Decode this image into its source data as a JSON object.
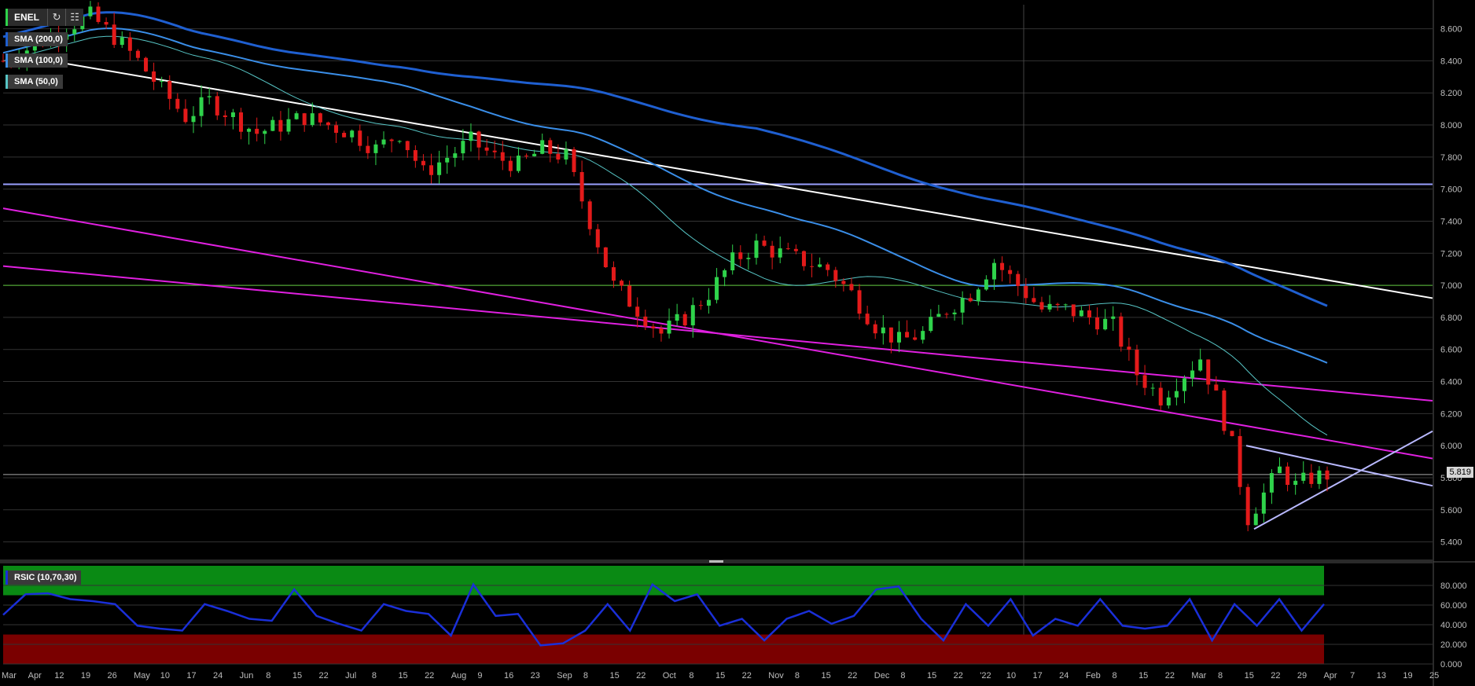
{
  "ticker": "ENEL",
  "toolbar": {
    "refresh_icon": "refresh-icon",
    "settings_icon": "bars-icon"
  },
  "legend": {
    "sma200": "SMA (200,0)",
    "sma100": "SMA (100,0)",
    "sma50": "SMA (50,0)"
  },
  "rsi_legend": "RSIC (10,70,30)",
  "last_price": "5.819",
  "colors": {
    "up": "#2fd34b",
    "down": "#e31a1a",
    "sma200": "#1f5fd0",
    "sma100": "#3a8ee8",
    "sma50": "#57c5c5",
    "channel": "#e020e0",
    "trend": "#ffffff",
    "resistance": "#9aa0ff",
    "support_green": "#5cc43a",
    "rsi": "#1a2fd8",
    "rsi_overbought": "#0a8a14",
    "rsi_oversold": "#7a0000"
  },
  "chart_data": {
    "type": "candlestick",
    "price_axis": {
      "range": [
        5.3,
        8.75
      ],
      "ticks": [
        "8.600",
        "8.400",
        "8.200",
        "8.000",
        "7.800",
        "7.600",
        "7.400",
        "7.200",
        "7.000",
        "6.800",
        "6.600",
        "6.400",
        "6.200",
        "6.000",
        "5.800",
        "5.600",
        "5.400"
      ]
    },
    "rsi_axis": {
      "range": [
        0,
        100
      ],
      "ticks": [
        "80.000",
        "60.000",
        "40.000",
        "20.000",
        "0.000"
      ]
    },
    "x_ticks": [
      "Mar",
      "Apr",
      "12",
      "19",
      "26",
      "May",
      "10",
      "17",
      "24",
      "Jun",
      "8",
      "15",
      "22",
      "Jul",
      "8",
      "15",
      "22",
      "Aug",
      "9",
      "16",
      "23",
      "Sep",
      "8",
      "15",
      "22",
      "Oct",
      "8",
      "15",
      "22",
      "Nov",
      "8",
      "15",
      "22",
      "Dec",
      "8",
      "15",
      "22",
      "'22",
      "10",
      "17",
      "24",
      "Feb",
      "8",
      "15",
      "22",
      "Mar",
      "8",
      "15",
      "22",
      "29",
      "Apr",
      "7",
      "13",
      "19",
      "25"
    ],
    "close_series": [
      [
        0,
        8.4
      ],
      [
        8,
        8.5
      ],
      [
        15,
        8.6
      ],
      [
        22,
        8.68
      ],
      [
        28,
        8.55
      ],
      [
        34,
        8.4
      ],
      [
        40,
        8.22
      ],
      [
        46,
        8.05
      ],
      [
        52,
        8.15
      ],
      [
        58,
        8.05
      ],
      [
        64,
        7.95
      ],
      [
        70,
        8.0
      ],
      [
        76,
        8.05
      ],
      [
        82,
        8.0
      ],
      [
        88,
        7.95
      ],
      [
        94,
        7.85
      ],
      [
        100,
        7.95
      ],
      [
        106,
        7.7
      ],
      [
        112,
        7.8
      ],
      [
        118,
        7.9
      ],
      [
        124,
        7.8
      ],
      [
        130,
        7.75
      ],
      [
        136,
        7.85
      ],
      [
        142,
        7.8
      ],
      [
        148,
        7.4
      ],
      [
        154,
        7.0
      ],
      [
        160,
        6.85
      ],
      [
        166,
        6.7
      ],
      [
        172,
        6.8
      ],
      [
        178,
        6.95
      ],
      [
        184,
        7.15
      ],
      [
        190,
        7.25
      ],
      [
        196,
        7.2
      ],
      [
        202,
        7.15
      ],
      [
        208,
        7.1
      ],
      [
        214,
        6.95
      ],
      [
        220,
        6.75
      ],
      [
        226,
        6.65
      ],
      [
        232,
        6.7
      ],
      [
        238,
        6.85
      ],
      [
        244,
        6.95
      ],
      [
        250,
        7.15
      ],
      [
        256,
        7.0
      ],
      [
        262,
        6.85
      ],
      [
        268,
        6.85
      ],
      [
        274,
        6.8
      ],
      [
        280,
        6.75
      ],
      [
        286,
        6.45
      ],
      [
        292,
        6.3
      ],
      [
        298,
        6.45
      ],
      [
        302,
        6.55
      ],
      [
        306,
        6.3
      ],
      [
        310,
        6.0
      ],
      [
        314,
        5.55
      ],
      [
        318,
        5.7
      ],
      [
        322,
        5.85
      ],
      [
        326,
        5.75
      ],
      [
        330,
        5.8
      ],
      [
        334,
        5.819
      ]
    ],
    "overlays": {
      "sma200_label": "SMA (200,0)",
      "sma100_label": "SMA (100,0)",
      "sma50_label": "SMA (50,0)",
      "horizontal_levels": [
        7.63,
        7.0,
        5.82
      ],
      "rsi_levels": [
        70,
        30
      ]
    },
    "rsi_series": [
      50,
      65,
      78,
      60,
      70,
      55,
      45,
      30,
      40,
      55,
      60,
      40,
      50,
      70,
      55,
      35,
      40,
      55,
      60,
      45,
      35,
      75,
      55,
      45,
      25,
      15,
      40,
      55,
      40,
      75,
      70,
      65,
      45,
      40,
      30,
      40,
      60,
      35,
      55,
      70,
      85,
      40,
      30,
      55,
      45,
      60,
      35,
      40,
      45,
      60,
      45,
      30,
      45,
      60,
      30,
      55,
      45,
      60,
      40,
      55
    ]
  }
}
